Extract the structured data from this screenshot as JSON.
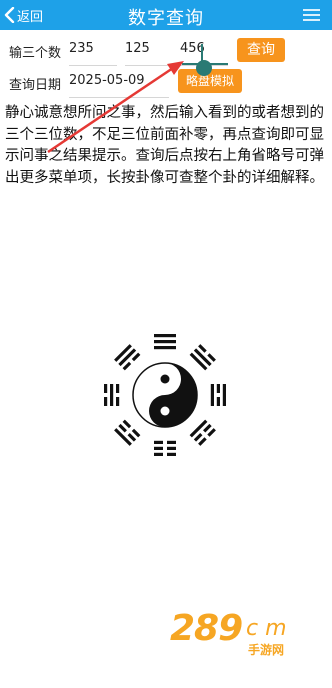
{
  "header": {
    "back_label": "返回",
    "title": "数字查询"
  },
  "form": {
    "numbers_label": "输三个数",
    "numbers": [
      "235",
      "125",
      "456"
    ],
    "query_button": "查询",
    "date_label": "查询日期",
    "date_value": "2025-05-09",
    "simulate_button": "略盘模拟"
  },
  "instructions": "静心诚意想所问之事，然后输入看到的或者想到的三个三位数，不足三位前面补零，再点查询即可显示问事之结果提示。查询后点按右上角省略号可弹出更多菜单项，长按卦像可查整个卦的详细解释。",
  "watermark": {
    "number": "289",
    "domain": "c m",
    "subtitle": "手游网"
  },
  "colors": {
    "header": "#1ea1e8",
    "button": "#f7941d",
    "arrow": "#e53935",
    "touch_marker": "#2a7a74"
  }
}
